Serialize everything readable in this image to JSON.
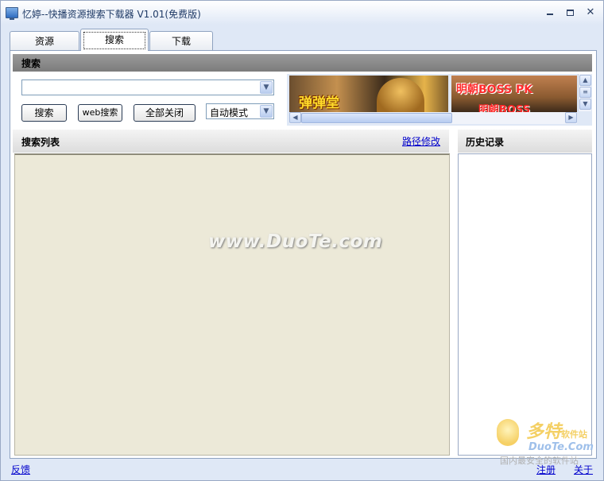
{
  "window": {
    "title": "忆婷--快播资源搜索下载器 V1.01(免费版)"
  },
  "tabs": [
    {
      "label": "资源"
    },
    {
      "label": "搜索"
    },
    {
      "label": "下载"
    }
  ],
  "search": {
    "section_title": "搜索",
    "query_value": "",
    "search_button": "搜索",
    "web_search_button": "web搜索",
    "close_all_button": "全部关闭",
    "mode_selected": "自动模式"
  },
  "banner": {
    "ad1_text": "弹弹堂",
    "ad2_line1": "明朝BOSS PK",
    "ad2_line2": "明朝BOSS"
  },
  "list": {
    "title": "搜索列表",
    "path_link": "路径修改",
    "watermark": "www.DuoTe.com"
  },
  "history": {
    "title": "历史记录"
  },
  "footer": {
    "feedback": "反馈",
    "register": "注册",
    "about": "关于"
  },
  "site_logo": {
    "cn": "多特",
    "cn_small": "软件站",
    "en": "DuoTe.Com",
    "tagline": "国内最安全的软件站"
  }
}
